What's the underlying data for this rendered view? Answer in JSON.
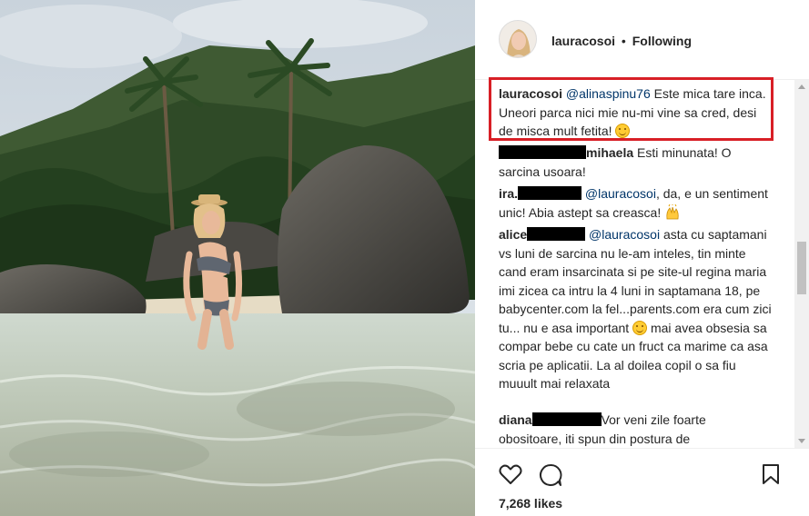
{
  "header": {
    "username": "lauracosoi",
    "separator": "•",
    "follow_status": "Following"
  },
  "comments": [
    {
      "user": "lauracosoi",
      "mention": "@alinaspinu76",
      "text": " Este mica tare inca. Uneori parca nici mie nu-mi vine sa cred, desi de misca mult fetita! ",
      "emoji": "smile-emoji",
      "highlighted": true
    },
    {
      "user": "mihaela",
      "user_redacted": true,
      "text": " Esti minunata! O sarcina usoara!"
    },
    {
      "user": "ira.",
      "user_redacted": true,
      "mention": "@lauracosoi",
      "text": ", da, e un sentiment unic! Abia astept sa creasca! ",
      "emoji": "raised-hands-emoji"
    },
    {
      "user": "alice",
      "user_redacted": true,
      "mention": "@lauracosoi",
      "text": " asta cu saptamani vs luni de sarcina nu le-am inteles, tin minte cand eram insarcinata si pe site-ul regina maria imi zicea ca intru la 4 luni in saptamana 18, pe babycenter.com la fel...parents.com era cum zici tu... nu e asa important ",
      "emoji": "smile-emoji",
      "text_after": " mai avea obsesia sa compar bebe cu cate un fruct ca marime ca asa scria pe aplicatii. La al doilea copil o sa fiu muuult mai relaxata"
    },
    {
      "user": "diana",
      "user_redacted": true,
      "text": "Vor veni zile foarte obositoare, iti spun din postura de"
    }
  ],
  "actions": {
    "like_icon": "heart-icon",
    "comment_icon": "comment-icon",
    "save_icon": "bookmark-icon",
    "likes_text": "7,268 likes"
  },
  "colors": {
    "highlight_border": "#d81f26",
    "text": "#262626",
    "mention": "#003569",
    "redaction": "#000000"
  }
}
